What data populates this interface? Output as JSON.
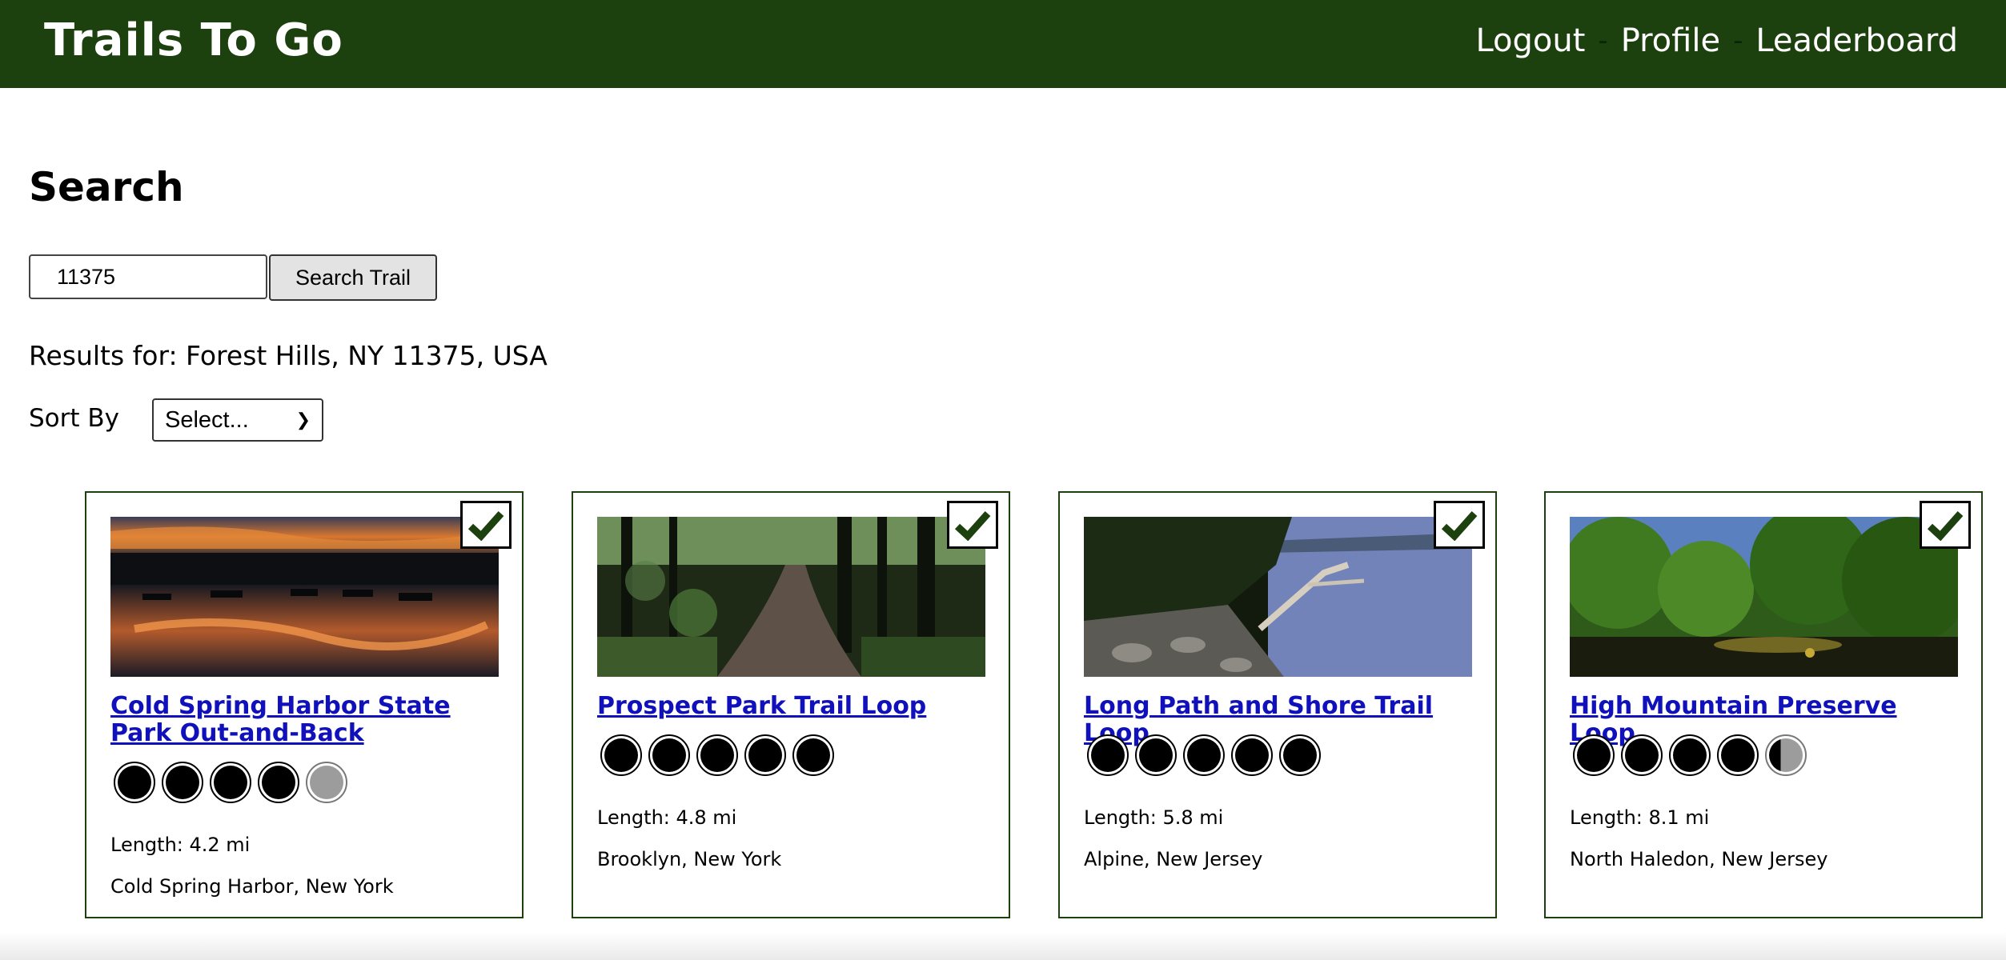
{
  "nav": {
    "brand": "Trails To Go",
    "links": [
      "Logout",
      "Profile",
      "Leaderboard"
    ],
    "separator": "-"
  },
  "search": {
    "title": "Search",
    "input_value": "11375",
    "button_label": "Search Trail",
    "results_text": "Results for: Forest Hills, NY 11375, USA"
  },
  "sort": {
    "label": "Sort By",
    "selected": "Select..."
  },
  "colors": {
    "header_bg": "#1d400f",
    "checkmark": "#1d400f",
    "link": "#1111bb"
  },
  "cards": [
    {
      "title": "Cold Spring Harbor State Park Out-and-Back",
      "rating": 4,
      "length": "Length: 4.2 mi",
      "location": "Cold Spring Harbor, New York",
      "checked": true,
      "photo": "sunset-lake-with-boats"
    },
    {
      "title": "Prospect Park Trail Loop",
      "rating": 5,
      "length": "Length: 4.8 mi",
      "location": "Brooklyn, New York",
      "checked": true,
      "photo": "forest-dirt-path"
    },
    {
      "title": "Long Path and Shore Trail Loop",
      "rating": 5,
      "length": "Length: 5.8 mi",
      "location": "Alpine, New Jersey",
      "checked": true,
      "photo": "rocky-river-shore"
    },
    {
      "title": "High Mountain Preserve Loop",
      "rating": 4.3,
      "length": "Length: 8.1 mi",
      "location": "North Haledon, New Jersey",
      "checked": true,
      "photo": "green-trees-over-pond"
    }
  ]
}
